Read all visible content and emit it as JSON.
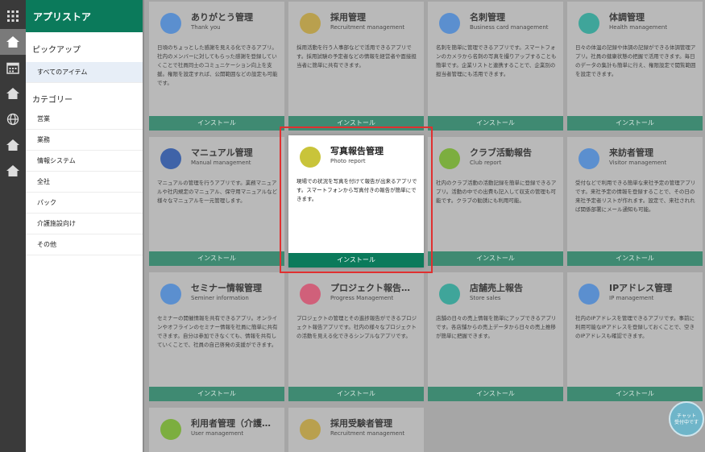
{
  "menu": {
    "title": "アプリストア",
    "pickup_label": "ピックアップ",
    "all_items_label": "すべてのアイテム",
    "category_label": "カテゴリー",
    "categories": [
      "営業",
      "業務",
      "情報システム",
      "全社",
      "パック",
      "介護施設向け",
      "その他"
    ]
  },
  "install_label": "インストール",
  "apps": [
    {
      "title": "ありがとう管理",
      "subtitle": "Thank you",
      "desc": "日頃のちょっとした感謝を見える化できるアプリ。社内のメンバーに対してもらった感謝を登録していくことで社員同士のコミュニケーション向上を支援。権限を設定すれば、公開範囲などの設定も可能です。",
      "color": "#5b8fcf"
    },
    {
      "title": "採用管理",
      "subtitle": "Recruitment management",
      "desc": "採用活動を行う人事部などで活用できるアプリです。採用試験の予定者などの情報を経営者や面接担当者に簡単に共有できます。",
      "color": "#b9a04e"
    },
    {
      "title": "名刺管理",
      "subtitle": "Business card management",
      "desc": "名刺を簡単に管理できるアプリです。スマートフォンのカメラから名刺の写真を撮りアップすることも簡単です。企業リストと連携することで、企業別の担当者管理にも活用できます。",
      "color": "#5b8fcf"
    },
    {
      "title": "体調管理",
      "subtitle": "Health management",
      "desc": "日々の体温の記録や体調の記録ができる体調管理アプリ。社員の健康状態の把握で活用できます。毎日のデータの集計も簡単に行え、権限設定で閲覧範囲を設定できます。",
      "color": "#3fa59a"
    },
    {
      "title": "マニュアル管理",
      "subtitle": "Manual management",
      "desc": "マニュアルの管理を行うアプリです。業務マニュアルや社内規定のマニュアル、保守用マニュアルなど様々なマニュアルを一元管理します。",
      "color": "#3f63a8"
    },
    {
      "title": "写真報告管理",
      "subtitle": "Photo report",
      "desc": "現場での状況を写真を付けて報告が出来るアプリです。スマートフォンから写真付きの報告が簡単にできます。",
      "color": "#c9c43a"
    },
    {
      "title": "クラブ活動報告",
      "subtitle": "Club report",
      "desc": "社内のクラブ活動の活動記録を簡単に登録できるアプリ。活動の中での出費も記入して収支の管理も可能です。クラブの勧誘にも利用可能。",
      "color": "#7cae3f"
    },
    {
      "title": "来訪者管理",
      "subtitle": "Visitor management",
      "desc": "受付などで利用できる簡単な来社予定の管理アプリです。来社予定の情報を登録することで、その日の来社予定者リストが作れます。設定で、来社されれば関係部署にメール通知も可能。",
      "color": "#5b8fcf"
    },
    {
      "title": "セミナー情報管理",
      "subtitle": "Seminer information",
      "desc": "セミナーの開催情報を共有できるアプリ。オンラインやオフラインのセミナー情報を社員に簡単に共有できます。自分は参加できなくても、情報を共有していくことで、社員の自己啓発の支援ができます。",
      "color": "#5b8fcf"
    },
    {
      "title": "プロジェクト報告…",
      "subtitle": "Progress Management",
      "desc": "プロジェクトの管理とその進捗報告ができるプロジェクト報告アプリです。社内の様々なプロジェクトの活動を見える化できるシンプルなアプリです。",
      "color": "#d0607a"
    },
    {
      "title": "店舗売上報告",
      "subtitle": "Store sales",
      "desc": "店舗の日々の売上情報を簡単にアップできるアプリです。各店舗からの売上データから日々の売上推移が簡単に把握できます。",
      "color": "#3fa59a"
    },
    {
      "title": "IPアドレス管理",
      "subtitle": "IP management",
      "desc": "社内のIPアドレスを管理できるアプリです。事前に利用可能なIPアドレスを登録しておくことで、空きのIPアドレスも確認できます。",
      "color": "#5b8fcf"
    },
    {
      "title": "利用者管理（介護…",
      "subtitle": "User management",
      "desc": "",
      "color": "#7cae3f"
    },
    {
      "title": "採用受験者管理",
      "subtitle": "Recruitment management",
      "desc": "",
      "color": "#b9a04e"
    }
  ],
  "chat": {
    "line1": "チャット",
    "line2": "受付中です"
  }
}
